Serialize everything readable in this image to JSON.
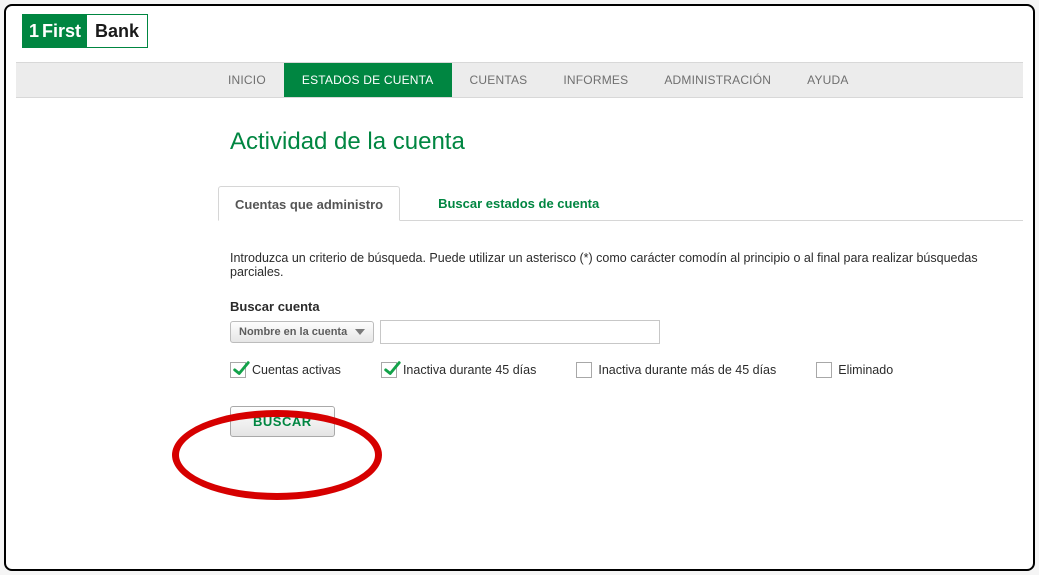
{
  "logo": {
    "part1": "1",
    "part2": "First",
    "part3": "Bank"
  },
  "nav": [
    {
      "label": "INICIO",
      "active": false
    },
    {
      "label": "ESTADOS DE CUENTA",
      "active": true
    },
    {
      "label": "CUENTAS",
      "active": false
    },
    {
      "label": "INFORMES",
      "active": false
    },
    {
      "label": "ADMINISTRACIÓN",
      "active": false
    },
    {
      "label": "AYUDA",
      "active": false
    }
  ],
  "page_title": "Actividad de la cuenta",
  "tabs": [
    {
      "label": "Cuentas que administro",
      "active": true
    },
    {
      "label": "Buscar estados de cuenta",
      "active": false
    }
  ],
  "intro": "Introduzca un criterio de búsqueda. Puede utilizar un asterisco (*) como carácter comodín al principio o al final para realizar búsquedas parciales.",
  "search": {
    "section_label": "Buscar cuenta",
    "dropdown_selected": "Nombre en la cuenta",
    "input_value": ""
  },
  "filters": [
    {
      "label": "Cuentas activas",
      "checked": true
    },
    {
      "label": "Inactiva durante 45 días",
      "checked": true
    },
    {
      "label": "Inactiva durante más de 45 días",
      "checked": false
    },
    {
      "label": "Eliminado",
      "checked": false
    }
  ],
  "buttons": {
    "search": "BUSCAR"
  },
  "colors": {
    "brand_green": "#008641",
    "highlight_red": "#d60000"
  }
}
